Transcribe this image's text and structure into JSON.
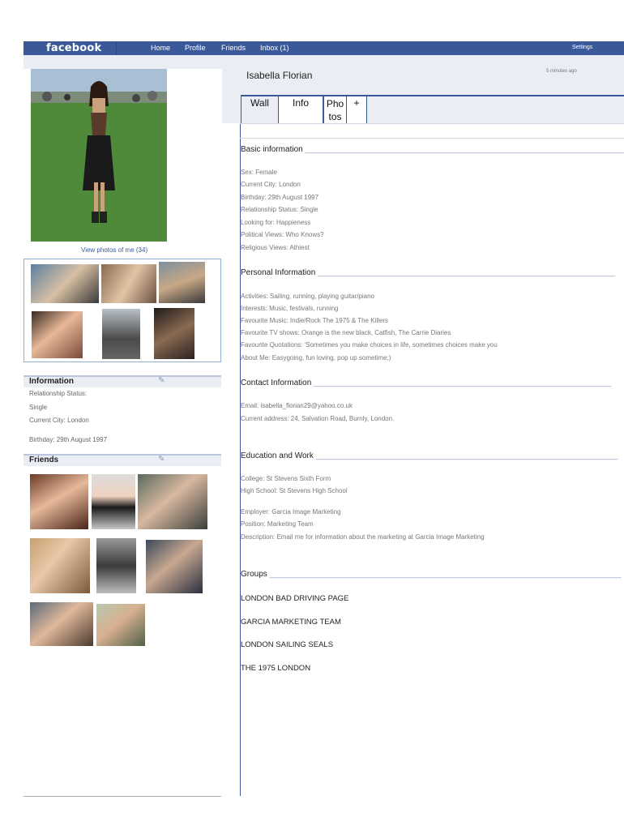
{
  "header": {
    "logo": "facebook",
    "nav": [
      "Home",
      "Profile",
      "Friends",
      "Inbox (1)"
    ],
    "settings": "Settings"
  },
  "profile": {
    "name": "Isabella Florian",
    "time_ago": "5 minutes ago",
    "view_photos": "View photos of me (34)"
  },
  "tabs": [
    {
      "label": "Wall"
    },
    {
      "label": "Info"
    },
    {
      "label": "Pho\ntos"
    },
    {
      "label": "+"
    }
  ],
  "sidebar": {
    "information": {
      "title": "Information",
      "lines": [
        "Relationship Status:",
        "Single",
        "Current City: London",
        "Birthday: 29th August 1997"
      ]
    },
    "friends": {
      "title": "Friends"
    }
  },
  "sections": {
    "basic": {
      "title": "Basic information",
      "lines": [
        "Sex: Female",
        "Current City: London",
        "Birthday: 29th August 1997",
        "Relationship Status: Single",
        "Looking for: Happieness",
        "Political Views:  Who Knows?",
        "Religious Views: Athiest"
      ]
    },
    "personal": {
      "title": "Personal Information",
      "lines": [
        "Activities: Sailing, running, playing guitar/piano",
        "Interests: Music, festivals, running",
        "Favourite Music: Indie/Rock  The 1975 & The Killers",
        "Favourite TV shows: Orange is the new black, Catfish, The Carrie Diaries",
        "Favourite Quotations: 'Sometimes you make choices in life, sometimes choices make you",
        "About Me: Easygoing, fun loving, pop up sometime;)"
      ]
    },
    "contact": {
      "title": "Contact Information",
      "lines": [
        "Email: isabella_florian29@yahoo.co.uk",
        "Current address: 24, Salvation Road, Burnly, London."
      ]
    },
    "education": {
      "title": "Education and Work",
      "lines": [
        "College: St Stevens Sixth Form",
        "High School: St Stevens High School",
        "Employer: Garcia Image Marketing",
        "Position: Marketing Team",
        "Description: Email me for information about the marketing at Garcia Image Marketing"
      ]
    },
    "groups": {
      "title": "Groups",
      "items": [
        "LONDON BAD DRIVING PAGE",
        "GARCIA MARKETING TEAM",
        "LONDON SAILING SEALS",
        "THE 1975 LONDON"
      ]
    }
  },
  "colors": {
    "brand": "#3b5998",
    "header_bg": "#eaedf4",
    "link": "#3b5998"
  }
}
